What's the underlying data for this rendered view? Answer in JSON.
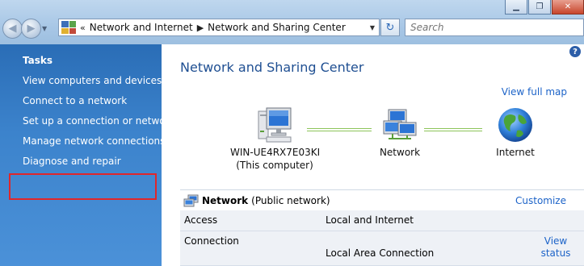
{
  "window": {
    "controls": [
      {
        "name": "minimize",
        "glyph": "▁"
      },
      {
        "name": "maximize",
        "glyph": "❐"
      },
      {
        "name": "close",
        "glyph": "✕"
      }
    ]
  },
  "navigation": {
    "back_glyph": "◀",
    "forward_glyph": "▶",
    "dropdown_glyph": "▼"
  },
  "address": {
    "prefix": "«",
    "breadcrumbs": [
      "Network and Internet",
      "Network and Sharing Center"
    ],
    "separator": "▶",
    "dropdown_glyph": "▼"
  },
  "refresh": {
    "glyph": "↻"
  },
  "search": {
    "placeholder": "Search"
  },
  "sidebar": {
    "heading": "Tasks",
    "items": [
      {
        "label": "View computers and devices"
      },
      {
        "label": "Connect to a network"
      },
      {
        "label": "Set up a connection or network"
      },
      {
        "label": "Manage network connections",
        "highlighted": true
      },
      {
        "label": "Diagnose and repair"
      }
    ]
  },
  "main": {
    "help_glyph": "?",
    "title": "Network and Sharing Center",
    "view_full_map": "View full map",
    "map": {
      "computer": {
        "name": "WIN-UE4RX7E03KI",
        "subtitle": "(This computer)"
      },
      "network": {
        "name": "Network"
      },
      "internet": {
        "name": "Internet"
      }
    },
    "network_section": {
      "name": "Network",
      "type": "(Public network)",
      "customize": "Customize",
      "rows": [
        {
          "key": "Access",
          "value": "Local and Internet"
        },
        {
          "key": "Connection",
          "value": "Local Area Connection",
          "action": "View status"
        }
      ]
    }
  },
  "colors": {
    "sidebar_top": "#2a6db6",
    "title_blue": "#1f4f92",
    "link_blue": "#1c63c8",
    "highlight_red": "#e0262a",
    "link_line_green": "#8cc45a"
  }
}
